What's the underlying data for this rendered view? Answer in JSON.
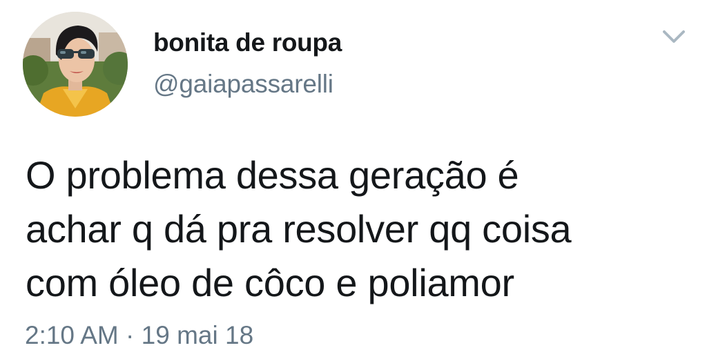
{
  "tweet": {
    "author": {
      "display_name": "bonita de roupa",
      "handle": "@gaiapassarelli"
    },
    "menu_icon": "chevron-down-icon",
    "text_lines": [
      "O problema dessa geração é",
      "achar q dá pra resolver qq coisa",
      "com óleo de côco e poliamor"
    ],
    "time": "2:10 AM",
    "separator": "·",
    "date": "19 mai 18"
  },
  "colors": {
    "text_primary": "#14171a",
    "text_secondary": "#657786",
    "chevron": "#aab8c2",
    "background": "#ffffff"
  }
}
